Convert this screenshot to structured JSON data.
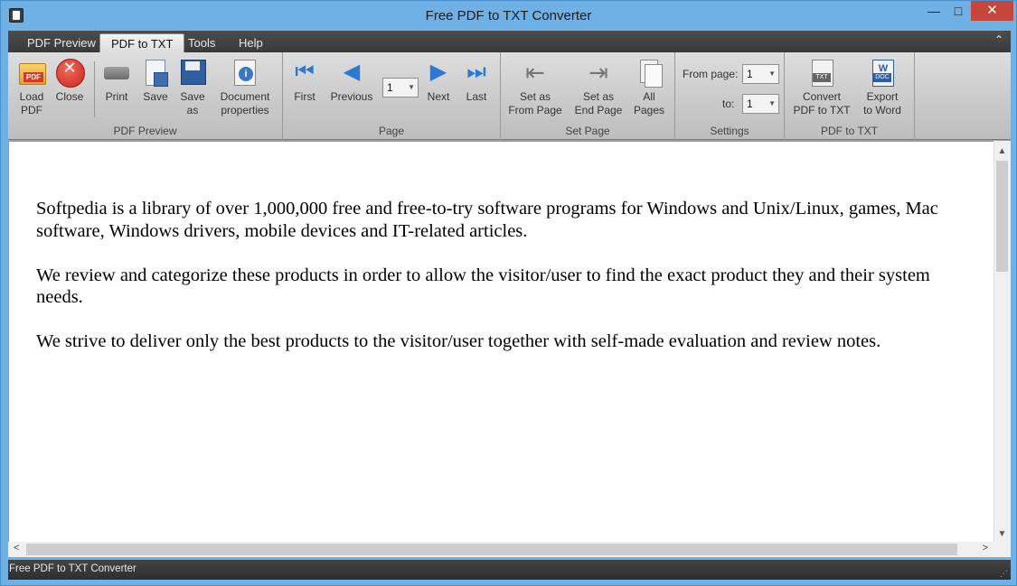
{
  "window": {
    "title": "Free PDF to TXT Converter",
    "minimize": "—",
    "maximize": "□",
    "close": "✕"
  },
  "tabs": [
    {
      "label": "PDF Preview"
    },
    {
      "label": "PDF to TXT"
    },
    {
      "label": "Tools"
    },
    {
      "label": "Help"
    }
  ],
  "collapse_glyph": "⌃",
  "ribbon": {
    "pdf_preview": {
      "label": "PDF Preview",
      "load": "Load\nPDF",
      "close": "Close",
      "print": "Print",
      "save": "Save",
      "save_as": "Save\nas",
      "doc_props": "Document\nproperties"
    },
    "page": {
      "label": "Page",
      "first": "First",
      "previous": "Previous",
      "page_value": "1",
      "next": "Next",
      "last": "Last"
    },
    "set_page": {
      "label": "Set Page",
      "from": "Set as\nFrom Page",
      "end": "Set as\nEnd Page",
      "all": "All\nPages"
    },
    "settings": {
      "label": "Settings",
      "from_label": "From page:",
      "from_value": "1",
      "to_label": "to:",
      "to_value": "1"
    },
    "pdf_to_txt": {
      "label": "PDF to TXT",
      "convert": "Convert\nPDF to TXT",
      "export": "Export\nto Word"
    }
  },
  "document": {
    "paragraphs": [
      "Softpedia is a library of over 1,000,000 free and free-to-try software programs for Windows and Unix/Linux, games, Mac software, Windows drivers, mobile devices and IT-related articles.",
      "We review and categorize these products in order to allow the visitor/user to find the exact product they and their system needs.",
      "We strive to deliver only the best products to the visitor/user together with self-made evaluation and review notes."
    ]
  },
  "statusbar": {
    "text": "Free PDF to TXT Converter"
  },
  "icons": {
    "app": "app-icon",
    "first": "first-page-icon",
    "previous": "previous-page-icon",
    "next": "next-page-icon",
    "last": "last-page-icon"
  },
  "glyphs": {
    "first": "⏮",
    "previous": "◀",
    "next": "▶",
    "last": "⏭",
    "dropdown": "▼",
    "scroll_up": "▲",
    "scroll_down": "▼",
    "scroll_left": "<",
    "scroll_right": ">",
    "grip": "⋰"
  }
}
